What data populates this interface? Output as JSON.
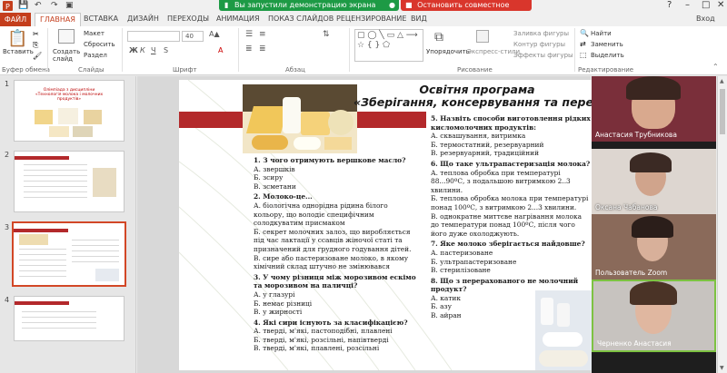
{
  "titlebar": {
    "share_status": "Вы запустили демонстрацию экрана",
    "stop_share": "Остановить совместное использование"
  },
  "ribbon_tabs": [
    "ФАЙЛ",
    "ГЛАВНАЯ",
    "ВСТАВКА",
    "ДИЗАЙН",
    "ПЕРЕХОДЫ",
    "АНИМАЦИЯ",
    "ПОКАЗ СЛАЙДОВ",
    "РЕЦЕНЗИРОВАНИЕ",
    "ВИД"
  ],
  "login_label": "Вход",
  "ribbon": {
    "paste": "Вставить",
    "clipboard_group": "Буфер обмена",
    "create_slide": "Создать слайд",
    "layout": "Макет",
    "reset": "Сбросить",
    "section": "Раздел",
    "slides_group": "Слайды",
    "font_group": "Шрифт",
    "font_size": "40",
    "paragraph_group": "Абзац",
    "arrange": "Упорядочить",
    "express_styles": "Экспресс-стили",
    "shape_fill": "Заливка фигуры",
    "shape_outline": "Контур фигуры",
    "shape_effects": "Эффекты фигуры",
    "drawing_group": "Рисование",
    "find": "Найти",
    "replace": "Заменить",
    "select": "Выделить",
    "editing_group": "Редактирование"
  },
  "thumbnails": [
    {
      "num": "1",
      "title": "Олімпіада з дисципліни «Технологія молока і молочних продуктів»"
    },
    {
      "num": "2",
      "title": ""
    },
    {
      "num": "3",
      "title": ""
    },
    {
      "num": "4",
      "title": ""
    }
  ],
  "slide": {
    "title_line1": "Освітня програма",
    "title_line2": "«Зберігання, консервування та перероб",
    "left_col": [
      {
        "q": "1. З чого отримують вершкове масло?",
        "a": [
          "А. звершків",
          "Б. зсиру",
          "В. зсметани"
        ]
      },
      {
        "q": "2. Молоко-це...",
        "a": [
          "А. біологічна однорідна рідина білого кольору, що володіє специфічним солодкуватим присмаком",
          "Б. секрет молочних залоз, що виробляється під час лактації у ссавців жіночої статі та призначений для грудного годування дітей.",
          "В. сире або пастеризоване молоко, в якому хімічний склад штучно не змінювався"
        ]
      },
      {
        "q": "3. У чому різниця між морозивом ескімо та морозивом на паличці?",
        "a": [
          "А. у глазурі",
          "Б. немає різниці",
          "В. у жирності"
        ]
      },
      {
        "q": "4. Які сири існують за класифікацією?",
        "a": [
          "А. тверді, м'які, пастоподібні, плавлені",
          "Б. тверді, м'які, розсільні, напівтверді",
          "В. тверді, м'які, плавлені, розсільні"
        ]
      }
    ],
    "right_col": [
      {
        "q": "5. Назвіть способи виготовлення рідких кисломолочних продуктів:",
        "a": [
          "А. сквашування, витримка",
          "Б. термостатний, резервуарний",
          "В. резервуарний, традиційний"
        ]
      },
      {
        "q": "6. Що таке ультрапастеризація молока?",
        "a": [
          "А. теплова обробка при температурі 88...90ºС, з подальшою витримкою 2..3 хвилини.",
          "Б. теплова обробка молока при температурі понад 100ºС, з витримкою 2...3 хвилини.",
          "В. однократне миттєве нагрівання молока до температури понад 100ºС, після чого його дуже охолоджують."
        ]
      },
      {
        "q": "7. Яке молоко зберігається найдовше?",
        "a": [
          "А. пастеризоване",
          "Б. ультрапастеризоване",
          "В. стерилізоване"
        ]
      },
      {
        "q": "8. Що з перерахованого не молочний продукт?",
        "a": [
          "А. катик",
          "Б. азу",
          "В. айран"
        ]
      }
    ]
  },
  "participants": [
    {
      "name": "Анастасия Трубникова"
    },
    {
      "name": "Оксана Чабанова"
    },
    {
      "name": "Пользователь Zoom"
    },
    {
      "name": "Черненко Анастасия"
    }
  ],
  "colors": {
    "accent": "#c43e1c",
    "share_green": "#1d9a45",
    "stop_red": "#d9362c",
    "slide_band": "#b3292b"
  }
}
